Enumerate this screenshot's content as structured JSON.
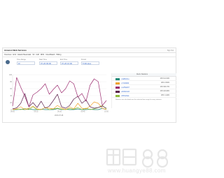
{
  "topbar": {
    "logo_text": "Amazon Web Services",
    "user_link": "Sign Out"
  },
  "nav": {
    "items": [
      {
        "label": "Overview"
      },
      {
        "label": "EC2"
      },
      {
        "label": "Elastic Beanstalk"
      },
      {
        "label": "S3"
      },
      {
        "label": "IAM"
      },
      {
        "label": "RDS"
      },
      {
        "label": "CloudWatch"
      },
      {
        "label": "Billing"
      }
    ]
  },
  "toolbar": {
    "stats": [
      {
        "label": "Time Range",
        "value": "1h"
      },
      {
        "label": "Start Time",
        "value": "07-26 09:00"
      },
      {
        "label": "End Time",
        "value": "07-26 10:00"
      },
      {
        "label": "Period",
        "value": "5 Minutes"
      }
    ]
  },
  "chart_data": {
    "type": "line",
    "x_count": 24,
    "ylim": [
      0,
      100
    ],
    "y_ticks": [
      "100",
      "80",
      "60",
      "40",
      "20",
      "0"
    ],
    "x_ticks": [
      "09:00",
      "09:15",
      "09:30",
      "09:45",
      "10:00"
    ],
    "series": [
      {
        "color": "#9b2a6e",
        "values": [
          10,
          92,
          64,
          38,
          8,
          42,
          50,
          60,
          74,
          44,
          58,
          70,
          48,
          60,
          82,
          74,
          36,
          46,
          24,
          70,
          88,
          80,
          12,
          26
        ]
      },
      {
        "color": "#5a1f4a",
        "values": [
          2,
          5,
          18,
          46,
          8,
          20,
          6,
          24,
          4,
          10,
          26,
          44,
          8,
          4,
          12,
          30,
          38,
          18,
          28,
          8,
          4,
          6,
          10,
          4
        ]
      },
      {
        "color": "#f0a22d",
        "values": [
          0,
          2,
          8,
          0,
          4,
          10,
          2,
          0,
          6,
          4,
          2,
          12,
          4,
          0,
          8,
          2,
          18,
          4,
          2,
          10,
          22,
          18,
          4,
          0
        ]
      },
      {
        "color": "#8fbc3c",
        "values": [
          0,
          1,
          0,
          3,
          0,
          8,
          0,
          0,
          6,
          0,
          2,
          4,
          1,
          0,
          3,
          1,
          6,
          0,
          4,
          0,
          2,
          6,
          12,
          2
        ]
      },
      {
        "color": "#1f8a77",
        "values": [
          0,
          0,
          1,
          0,
          2,
          0,
          0,
          1,
          0,
          0,
          0,
          3,
          0,
          1,
          0,
          0,
          2,
          0,
          0,
          1,
          0,
          0,
          4,
          0
        ]
      }
    ]
  },
  "chart_footer": {
    "date_label": "2013-07-26"
  },
  "legend": {
    "header": "Metric Statistics",
    "rows": [
      {
        "name": "i-4a8b2c1e",
        "value": "CPU 12.31%",
        "color": "#1f8a77"
      },
      {
        "name": "i-7c3d9f20",
        "value": "CPU 2.50%",
        "color": "#f0a22d"
      },
      {
        "name": "i-1e55ab07",
        "value": "CPU 68.17%",
        "color": "#9b2a6e"
      },
      {
        "name": "i-2b90c4d3",
        "value": "CPU 20.46%",
        "color": "#5a1f4a"
      },
      {
        "name": "i-9f01e6aa",
        "value": "CPU 1.42%",
        "color": "#8fbc3c"
      }
    ],
    "note": "Statistics are calculated over the selected time range for every instance."
  },
  "watermark": {
    "url": "www.huangye88.com"
  }
}
